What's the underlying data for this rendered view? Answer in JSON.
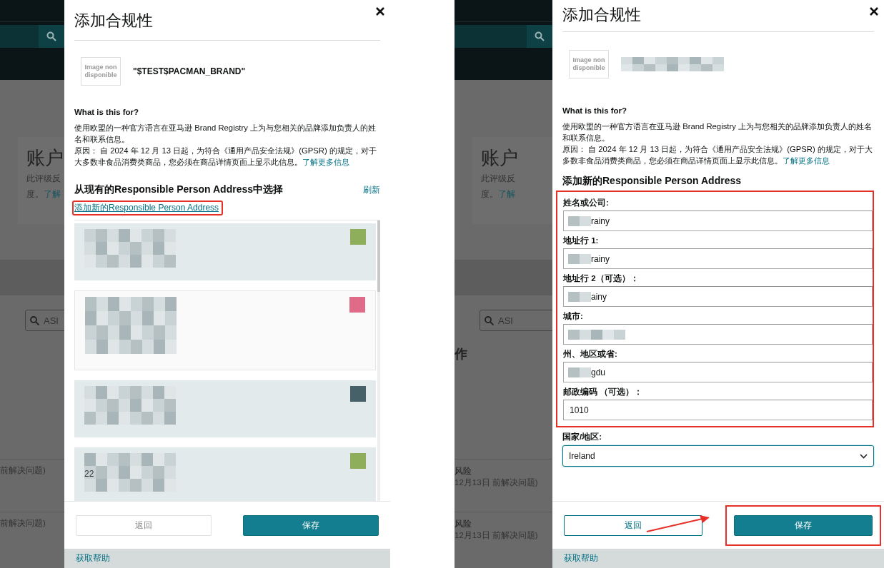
{
  "screens": [
    {
      "background": {
        "heading": "账户",
        "text_lines": [
          "此评级反",
          "度。"
        ],
        "link": "了解",
        "search_text": "ASI",
        "rows": [
          {
            "note": "前解决问题)"
          },
          {
            "note": "前解决问题)"
          }
        ]
      },
      "dialog": {
        "kind": "select",
        "title": "添加合规性",
        "image_placeholder": "Image non disponible",
        "brand": "\"$TEST$PACMAN_BRAND\"",
        "brand_redacted": false,
        "info_heading": "What is this for?",
        "description": "使用欧盟的一种官方语言在亚马逊 Brand Registry 上为与您相关的品牌添加负责人的姓名和联系信息。",
        "reason": "原因： 自 2024 年 12 月 13 日起，为符合《通用产品安全法规》(GPSR) 的规定，对于大多数非食品消费类商品，您必须在商品详情页面上显示此信息。",
        "learn_more": "了解更多信息",
        "list_heading": "从现有的Responsible Person Address中选择",
        "refresh": "刷新",
        "add_link": "添加新的Responsible Person Address",
        "add_link_annotated": true,
        "addresses": [
          {
            "highlighted": true,
            "color": "#8fae5c"
          },
          {
            "highlighted": false,
            "color": "#df6b88"
          },
          {
            "highlighted": true,
            "color": "#466268"
          },
          {
            "highlighted": true,
            "color": "#8fae5c",
            "text": "22"
          }
        ],
        "buttons": [
          {
            "label": "返回",
            "kind": "secondary",
            "disabled": true
          },
          {
            "label": "保存",
            "kind": "primary",
            "disabled": false
          }
        ],
        "help": "获取帮助"
      }
    },
    {
      "background": {
        "heading": "账户",
        "text_lines": [
          "此评级反",
          "度。"
        ],
        "link": "了解",
        "search_text": "ASI",
        "section_heading": "作",
        "rows": [
          {
            "title": "风险",
            "note": "12月13日 前解决问题)"
          },
          {
            "title": "风险",
            "note": "12月13日 前解决问题)"
          }
        ]
      },
      "dialog": {
        "kind": "form",
        "title": "添加合规性",
        "image_placeholder": "Image non disponible",
        "brand_redacted": true,
        "info_heading": "What is this for?",
        "description": "使用欧盟的一种官方语言在亚马逊 Brand Registry 上为与您相关的品牌添加负责人的姓名和联系信息。",
        "reason": "原因： 自 2024 年 12 月 13 日起，为符合《通用产品安全法规》(GPSR) 的规定，对于大多数非食品消费类商品，您必须在商品详情页面上显示此信息。",
        "learn_more": "了解更多信息",
        "form_heading": "添加新的Responsible Person Address",
        "fields_annotated": true,
        "fields": [
          {
            "label": "姓名或公司:",
            "value": "rainy",
            "redacted": true
          },
          {
            "label": "地址行 1:",
            "value": "rainy",
            "redacted": true
          },
          {
            "label": "地址行 2（可选）：",
            "value": "ainy",
            "redacted": true
          },
          {
            "label": "城市:",
            "redacted": true
          },
          {
            "label": "州、地区或省:",
            "value": "gdu",
            "redacted": true
          },
          {
            "label": "邮政编码 （可选）：",
            "value": "1010",
            "redacted": false
          }
        ],
        "country": {
          "label": "国家/地区:",
          "value": "Ireland"
        },
        "buttons": [
          {
            "label": "返回",
            "kind": "secondary",
            "disabled": false
          },
          {
            "label": "保存",
            "kind": "primary",
            "disabled": false
          }
        ],
        "save_annotated": true,
        "arrow_annotation": true,
        "help": "获取帮助"
      }
    }
  ]
}
